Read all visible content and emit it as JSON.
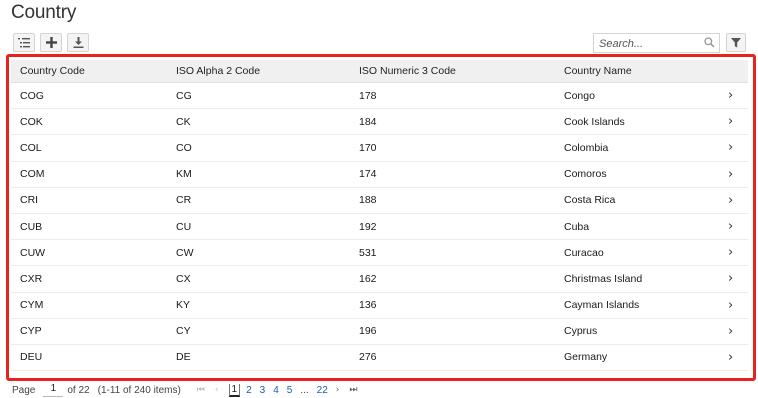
{
  "page_title": "Country",
  "toolbar": {
    "icons": [
      "list-view-icon",
      "plus-icon",
      "download-icon"
    ]
  },
  "search": {
    "placeholder": "Search..."
  },
  "table": {
    "headers": [
      "Country Code",
      "ISO Alpha 2 Code",
      "ISO Numeric 3 Code",
      "Country Name"
    ],
    "rows": [
      {
        "code": "COG",
        "alpha2": "CG",
        "numeric": "178",
        "name": "Congo"
      },
      {
        "code": "COK",
        "alpha2": "CK",
        "numeric": "184",
        "name": "Cook Islands"
      },
      {
        "code": "COL",
        "alpha2": "CO",
        "numeric": "170",
        "name": "Colombia"
      },
      {
        "code": "COM",
        "alpha2": "KM",
        "numeric": "174",
        "name": "Comoros"
      },
      {
        "code": "CRI",
        "alpha2": "CR",
        "numeric": "188",
        "name": "Costa Rica"
      },
      {
        "code": "CUB",
        "alpha2": "CU",
        "numeric": "192",
        "name": "Cuba"
      },
      {
        "code": "CUW",
        "alpha2": "CW",
        "numeric": "531",
        "name": "Curacao"
      },
      {
        "code": "CXR",
        "alpha2": "CX",
        "numeric": "162",
        "name": "Christmas Island"
      },
      {
        "code": "CYM",
        "alpha2": "KY",
        "numeric": "136",
        "name": "Cayman Islands"
      },
      {
        "code": "CYP",
        "alpha2": "CY",
        "numeric": "196",
        "name": "Cyprus"
      },
      {
        "code": "DEU",
        "alpha2": "DE",
        "numeric": "276",
        "name": "Germany"
      }
    ]
  },
  "pager": {
    "label": "Page",
    "current": "1",
    "of_text": "of 22",
    "range_text": "(1-11 of 240 items)",
    "pages": [
      "1",
      "2",
      "3",
      "4",
      "5"
    ],
    "ellipsis": "...",
    "last_page": "22"
  },
  "colors": {
    "highlight": "#e8231f",
    "link": "#1c5ab0",
    "header_bg": "#f0f0f0"
  }
}
